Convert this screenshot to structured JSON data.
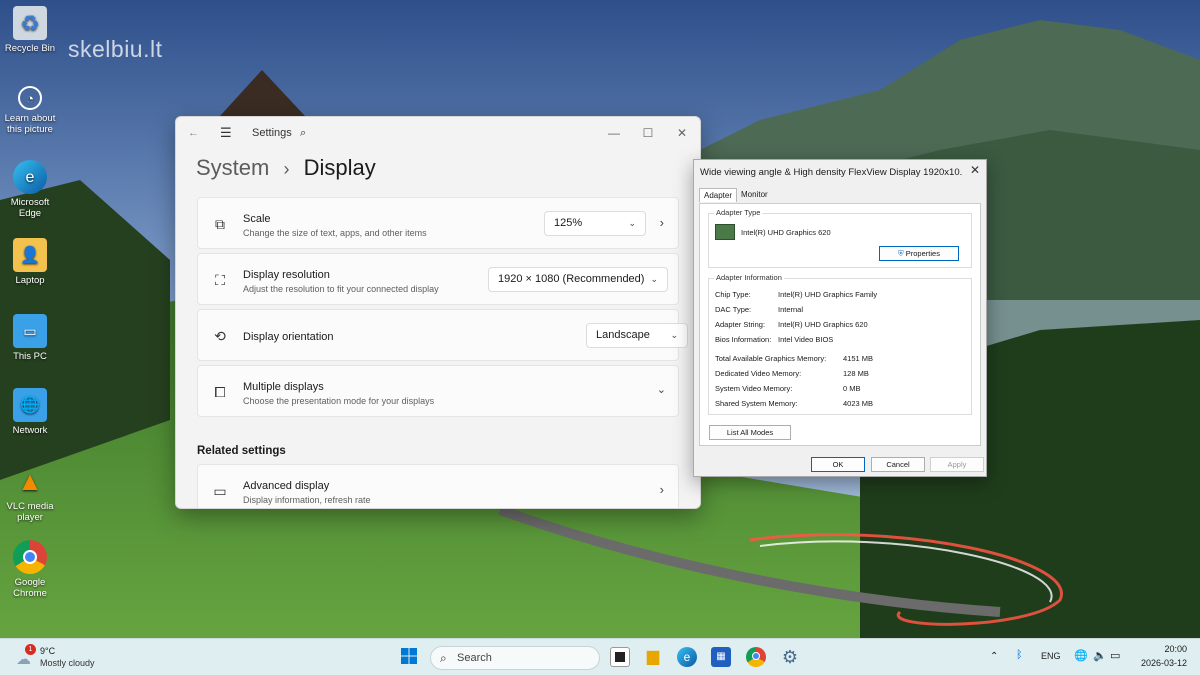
{
  "desktop": {
    "watermark": "skelbiu.lt",
    "icons": [
      {
        "label": "Recycle Bin",
        "icon": "recycle-bin-icon"
      },
      {
        "label": "Learn about this picture",
        "icon": "learn-picture-icon"
      },
      {
        "label": "Microsoft Edge",
        "icon": "edge-icon"
      },
      {
        "label": "Laptop",
        "icon": "user-folder-icon"
      },
      {
        "label": "This PC",
        "icon": "monitor-icon"
      },
      {
        "label": "Network",
        "icon": "network-icon"
      },
      {
        "label": "VLC media player",
        "icon": "vlc-icon"
      },
      {
        "label": "Google Chrome",
        "icon": "chrome-icon"
      }
    ]
  },
  "settings": {
    "app_title": "Settings",
    "breadcrumb": {
      "parent": "System",
      "current": "Display"
    },
    "cards": [
      {
        "title": "Scale",
        "subtitle": "Change the size of text, apps, and other items",
        "value": "125%"
      },
      {
        "title": "Display resolution",
        "subtitle": "Adjust the resolution to fit your connected display",
        "value": "1920 × 1080 (Recommended)"
      },
      {
        "title": "Display orientation",
        "subtitle": "",
        "value": "Landscape"
      },
      {
        "title": "Multiple displays",
        "subtitle": "Choose the presentation mode for your displays"
      }
    ],
    "related_title": "Related settings",
    "advanced": {
      "title": "Advanced display",
      "subtitle": "Display information, refresh rate"
    }
  },
  "dialog": {
    "title": "Wide viewing angle & High density FlexView Display 1920x10...",
    "tabs": [
      "Adapter",
      "Monitor"
    ],
    "adapter_type_label": "Adapter Type",
    "adapter_name": "Intel(R) UHD Graphics 620",
    "properties_button": "Properties",
    "adapter_info_label": "Adapter Information",
    "info": [
      {
        "key": "Chip Type:",
        "value": "Intel(R) UHD Graphics Family"
      },
      {
        "key": "DAC Type:",
        "value": "Internal"
      },
      {
        "key": "Adapter String:",
        "value": "Intel(R) UHD Graphics 620"
      },
      {
        "key": "Bios Information:",
        "value": "Intel Video BIOS"
      }
    ],
    "memory": [
      {
        "key": "Total Available Graphics Memory:",
        "value": "4151 MB"
      },
      {
        "key": "Dedicated Video Memory:",
        "value": "128 MB"
      },
      {
        "key": "System Video Memory:",
        "value": "0 MB"
      },
      {
        "key": "Shared System Memory:",
        "value": "4023 MB"
      }
    ],
    "list_modes_button": "List All Modes",
    "ok": "OK",
    "cancel": "Cancel",
    "apply": "Apply"
  },
  "taskbar": {
    "weather": {
      "temp": "9°C",
      "condition": "Mostly cloudy",
      "badge": "1"
    },
    "search_placeholder": "Search",
    "language": "ENG",
    "time": "20:00",
    "date": "2026-03-12"
  }
}
